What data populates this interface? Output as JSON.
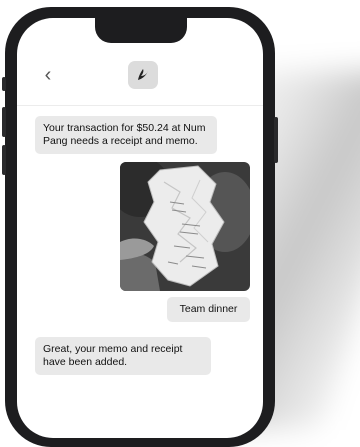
{
  "header": {
    "back_icon": "chevron-left-icon",
    "app_logo_icon": "bird-logo-icon"
  },
  "messages": {
    "incoming_1": "Your transaction for $50.24 at Num Pang needs a receipt and memo.",
    "outgoing_photo_icon": "receipt-photo",
    "outgoing_text": "Team dinner",
    "incoming_2": "Great, your memo and receipt have been added."
  },
  "colors": {
    "phone_frame": "#1d1d1f",
    "bubble_bg": "#e9e9e9",
    "screen_bg": "#ffffff"
  }
}
